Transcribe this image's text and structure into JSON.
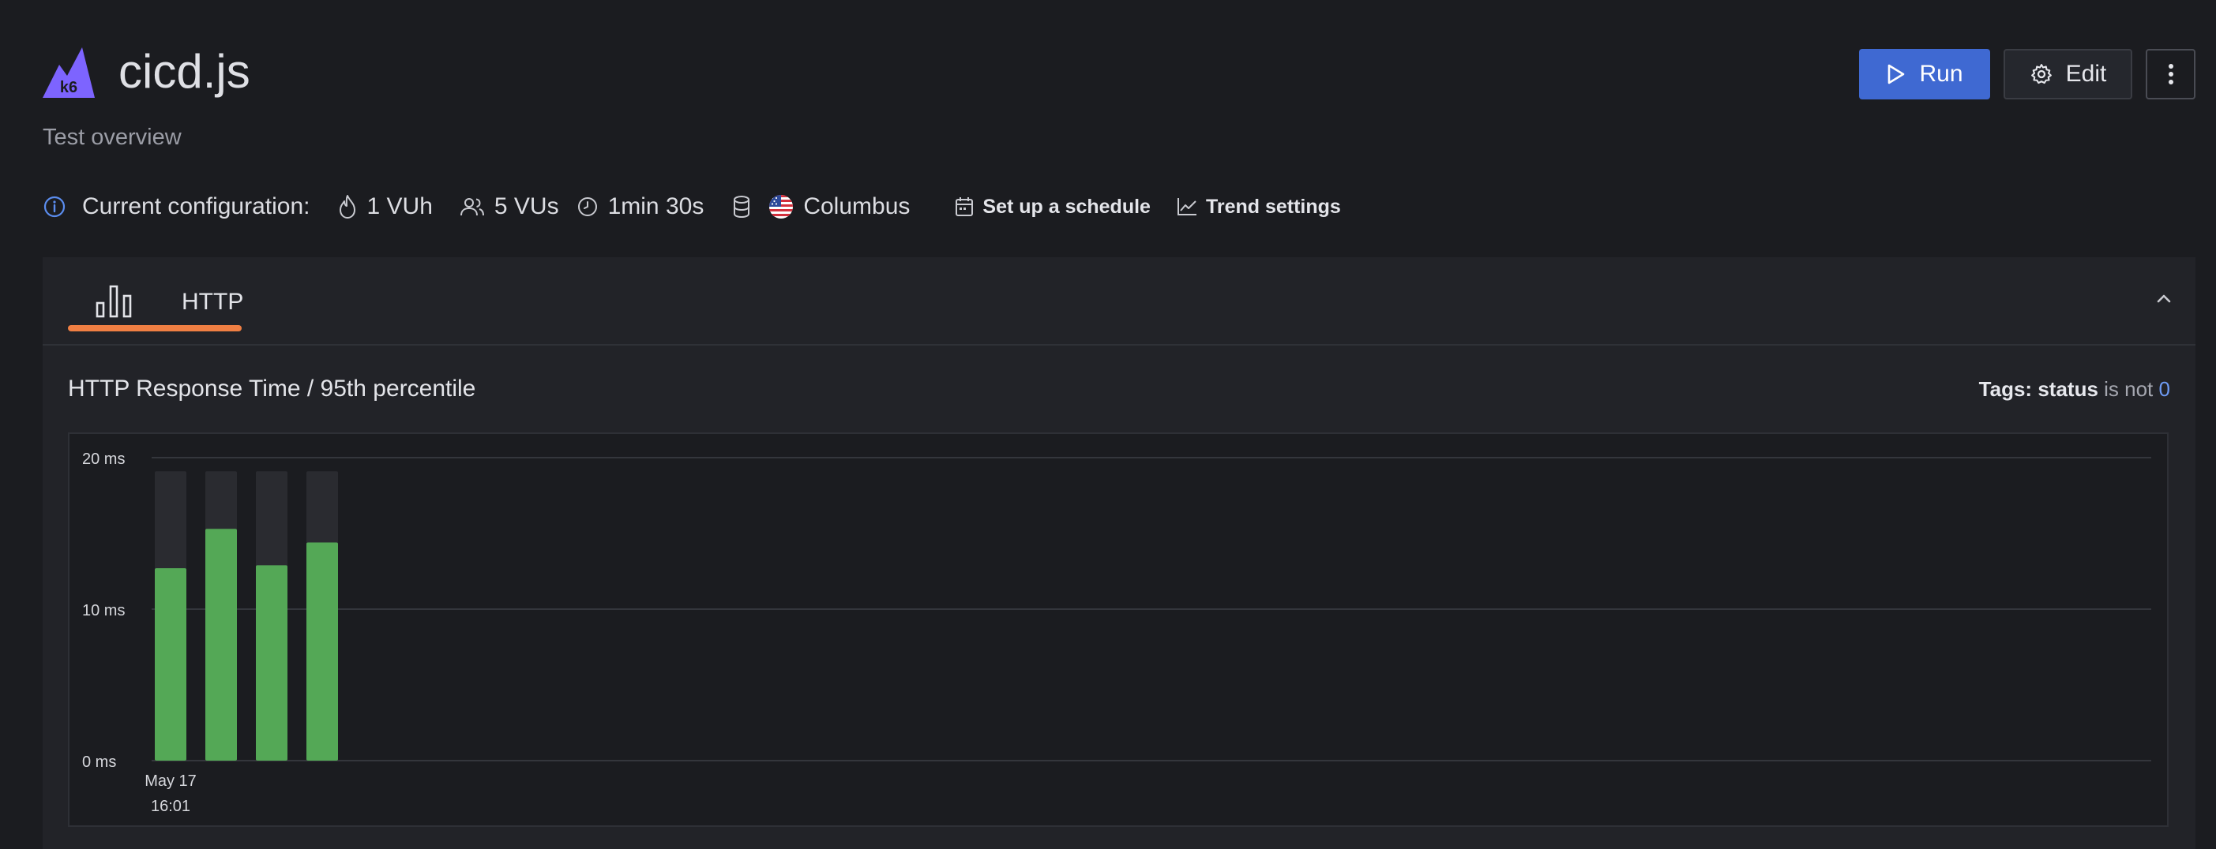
{
  "header": {
    "title": "cicd.js",
    "subtitle": "Test overview",
    "logo_text": "k6",
    "run_label": "Run",
    "edit_label": "Edit"
  },
  "config": {
    "label": "Current configuration:",
    "vuh": "1 VUh",
    "vus": "5 VUs",
    "duration": "1min 30s",
    "location": "Columbus",
    "schedule_label": "Set up a schedule",
    "trend_label": "Trend settings"
  },
  "tabs": [
    {
      "label": "HTTP",
      "icon": "bar-chart-icon"
    }
  ],
  "chart": {
    "title": "HTTP Response Time / 95th percentile",
    "tags_label": "Tags:",
    "tags_key": "status",
    "tags_op": "is not",
    "tags_value": "0"
  },
  "chart_data": {
    "type": "bar",
    "title": "HTTP Response Time / 95th percentile",
    "xlabel": "",
    "ylabel": "",
    "ylim": [
      0,
      20
    ],
    "yticks": [
      "0 ms",
      "10 ms",
      "20 ms"
    ],
    "x_tick_label": [
      "May 17",
      "16:01"
    ],
    "grid": true,
    "values": [
      12.7,
      15.3,
      12.9,
      14.4
    ],
    "max_values": [
      19.1,
      19.1,
      19.1,
      19.1
    ],
    "color": "#54a856",
    "background_bar_color": "#2a2b30"
  },
  "colors": {
    "accent": "#3f69d2",
    "tab_underline": "#f07f43",
    "logo": "#7d64ff",
    "bar": "#54a856"
  }
}
